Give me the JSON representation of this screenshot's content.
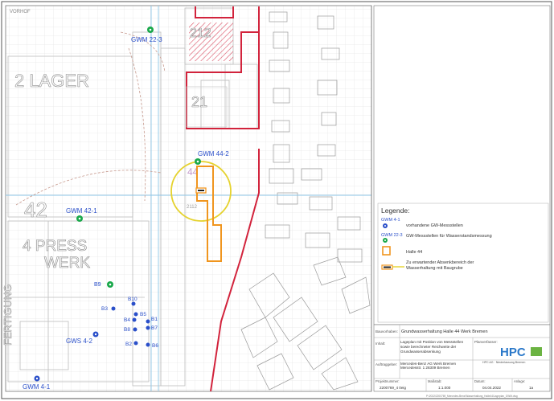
{
  "map": {
    "street_top_left": "VORHOF",
    "building_labels": {
      "lager": "2 LAGER",
      "press": "4 PRESS",
      "werk": "WERK",
      "fertigung": "FERTIGUNG",
      "num_42": "42",
      "num_212": "212",
      "num_21": "21",
      "num_44": "44",
      "num_2112": "2112"
    },
    "wells_green": [
      {
        "label": "GWM 22-3"
      },
      {
        "label": "GWM 44-2"
      },
      {
        "label": "GWM 42-1"
      },
      {
        "label": "B9"
      }
    ],
    "wells_blue": [
      {
        "label": "GWS 4-2"
      },
      {
        "label": "GWM 4-1"
      },
      {
        "label": "B3"
      },
      {
        "label": "B5"
      },
      {
        "label": "B4"
      },
      {
        "label": "B1"
      },
      {
        "label": "B7"
      },
      {
        "label": "B2"
      },
      {
        "label": "B8"
      },
      {
        "label": "B6"
      },
      {
        "label": "B10"
      }
    ],
    "colors": {
      "green_well": "#19a84a",
      "blue_well": "#2a4fc9",
      "hall_outline": "#f0951e",
      "influence_circle": "#e5d22e",
      "red_boundary": "#d2233c",
      "grid": "#e4e4e4",
      "blue_line": "#8ec7e8",
      "hatch": "#d2233c"
    }
  },
  "legend": {
    "title": "Legende:",
    "items": [
      {
        "symbol": "GWM 4-1",
        "text": "vorhandene GW-Messstellen"
      },
      {
        "symbol": "GWM 22-3",
        "text": "GW-Messstellen für Wasserstandsmessung"
      },
      {
        "symbol": "",
        "text": "Halle 44"
      },
      {
        "symbol": "",
        "text": "Zu erwartender Absenkbereich der Wasserhaltung mit Baugrube"
      }
    ]
  },
  "title_block": {
    "project_label": "Bauvorhaben:",
    "project": "Grundwasserhaltung Halle 44 Werk Bremen",
    "content_label": "Inhalt:",
    "content": "Lageplan mit Position von Messstellen sowie berechneter Reichweite der Grundwasserabsenkung",
    "client_label": "Auftraggeber:",
    "client": "Mercedes-Benz AG Werk Bremen Mercedesstr. 1 28309 Bremen",
    "planner_label": "Planverfasser:",
    "company_logo": "HPC",
    "company_sub": "HPC AG · Niederlassung Bremen",
    "scale_label": "Maßstab:",
    "scale": "1:1.000",
    "date_label": "Datum:",
    "date": "04.04.2022",
    "plan_label": "Anlage:",
    "plan_no": "1a",
    "project_no_label": "Projektnummer:",
    "project_no": "2200769_4 0eig",
    "footer": "P:\\2022\\2200769_Mercedes-Benz\\Wasserhaltung_Halle44\\Lageplan_GWM.dwg"
  }
}
